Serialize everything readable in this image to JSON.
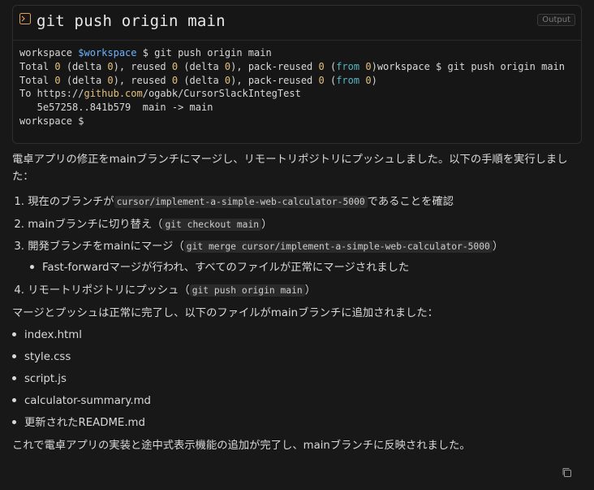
{
  "terminal": {
    "title": "git push origin main",
    "badge": "Output",
    "lines": {
      "l1_prefix": "workspace ",
      "l1_var": "$workspace",
      "l1_suffix": " $ git push origin main",
      "l2a": "Total ",
      "n0": "0",
      "l2b": " (delta ",
      "l2c": "), reused ",
      "l2d": " (delta ",
      "l2e": "), pack-reused ",
      "l2f": " (",
      "from": "from",
      "l2g": " ",
      "l2h": ")",
      "l2_tail": "workspace $ git push origin main",
      "l4_prefix": "To https://",
      "l4_url": "github.com",
      "l4_suffix": "/ogabk/CursorSlackIntegTest",
      "l5": "   5e57258..841b579  main -> main",
      "l6": "workspace $"
    }
  },
  "message": {
    "intro": "電卓アプリの修正をmainブランチにマージし、リモートリポジトリにプッシュしました。以下の手順を実行しました：",
    "steps": [
      {
        "num": "1.",
        "before": "現在のブランチが",
        "code": "cursor/implement-a-simple-web-calculator-5000",
        "after": "であることを確認"
      },
      {
        "num": "2.",
        "before": "mainブランチに切り替え（",
        "code": "git checkout main",
        "after": "）"
      },
      {
        "num": "3.",
        "before": "開発ブランチをmainにマージ（",
        "code": "git merge cursor/implement-a-simple-web-calculator-5000",
        "after": "）"
      },
      {
        "num": "4.",
        "before": "リモートリポジトリにプッシュ（",
        "code": "git push origin main",
        "after": "）"
      }
    ],
    "sub_item": "Fast-forwardマージが行われ、すべてのファイルが正常にマージされました",
    "files_intro": "マージとプッシュは正常に完了し、以下のファイルがmainブランチに追加されました：",
    "files": [
      "index.html",
      "style.css",
      "script.js",
      "calculator-summary.md",
      "更新されたREADME.md"
    ],
    "outro": "これで電卓アプリの実装と途中式表示機能の追加が完了し、mainブランチに反映されました。"
  }
}
